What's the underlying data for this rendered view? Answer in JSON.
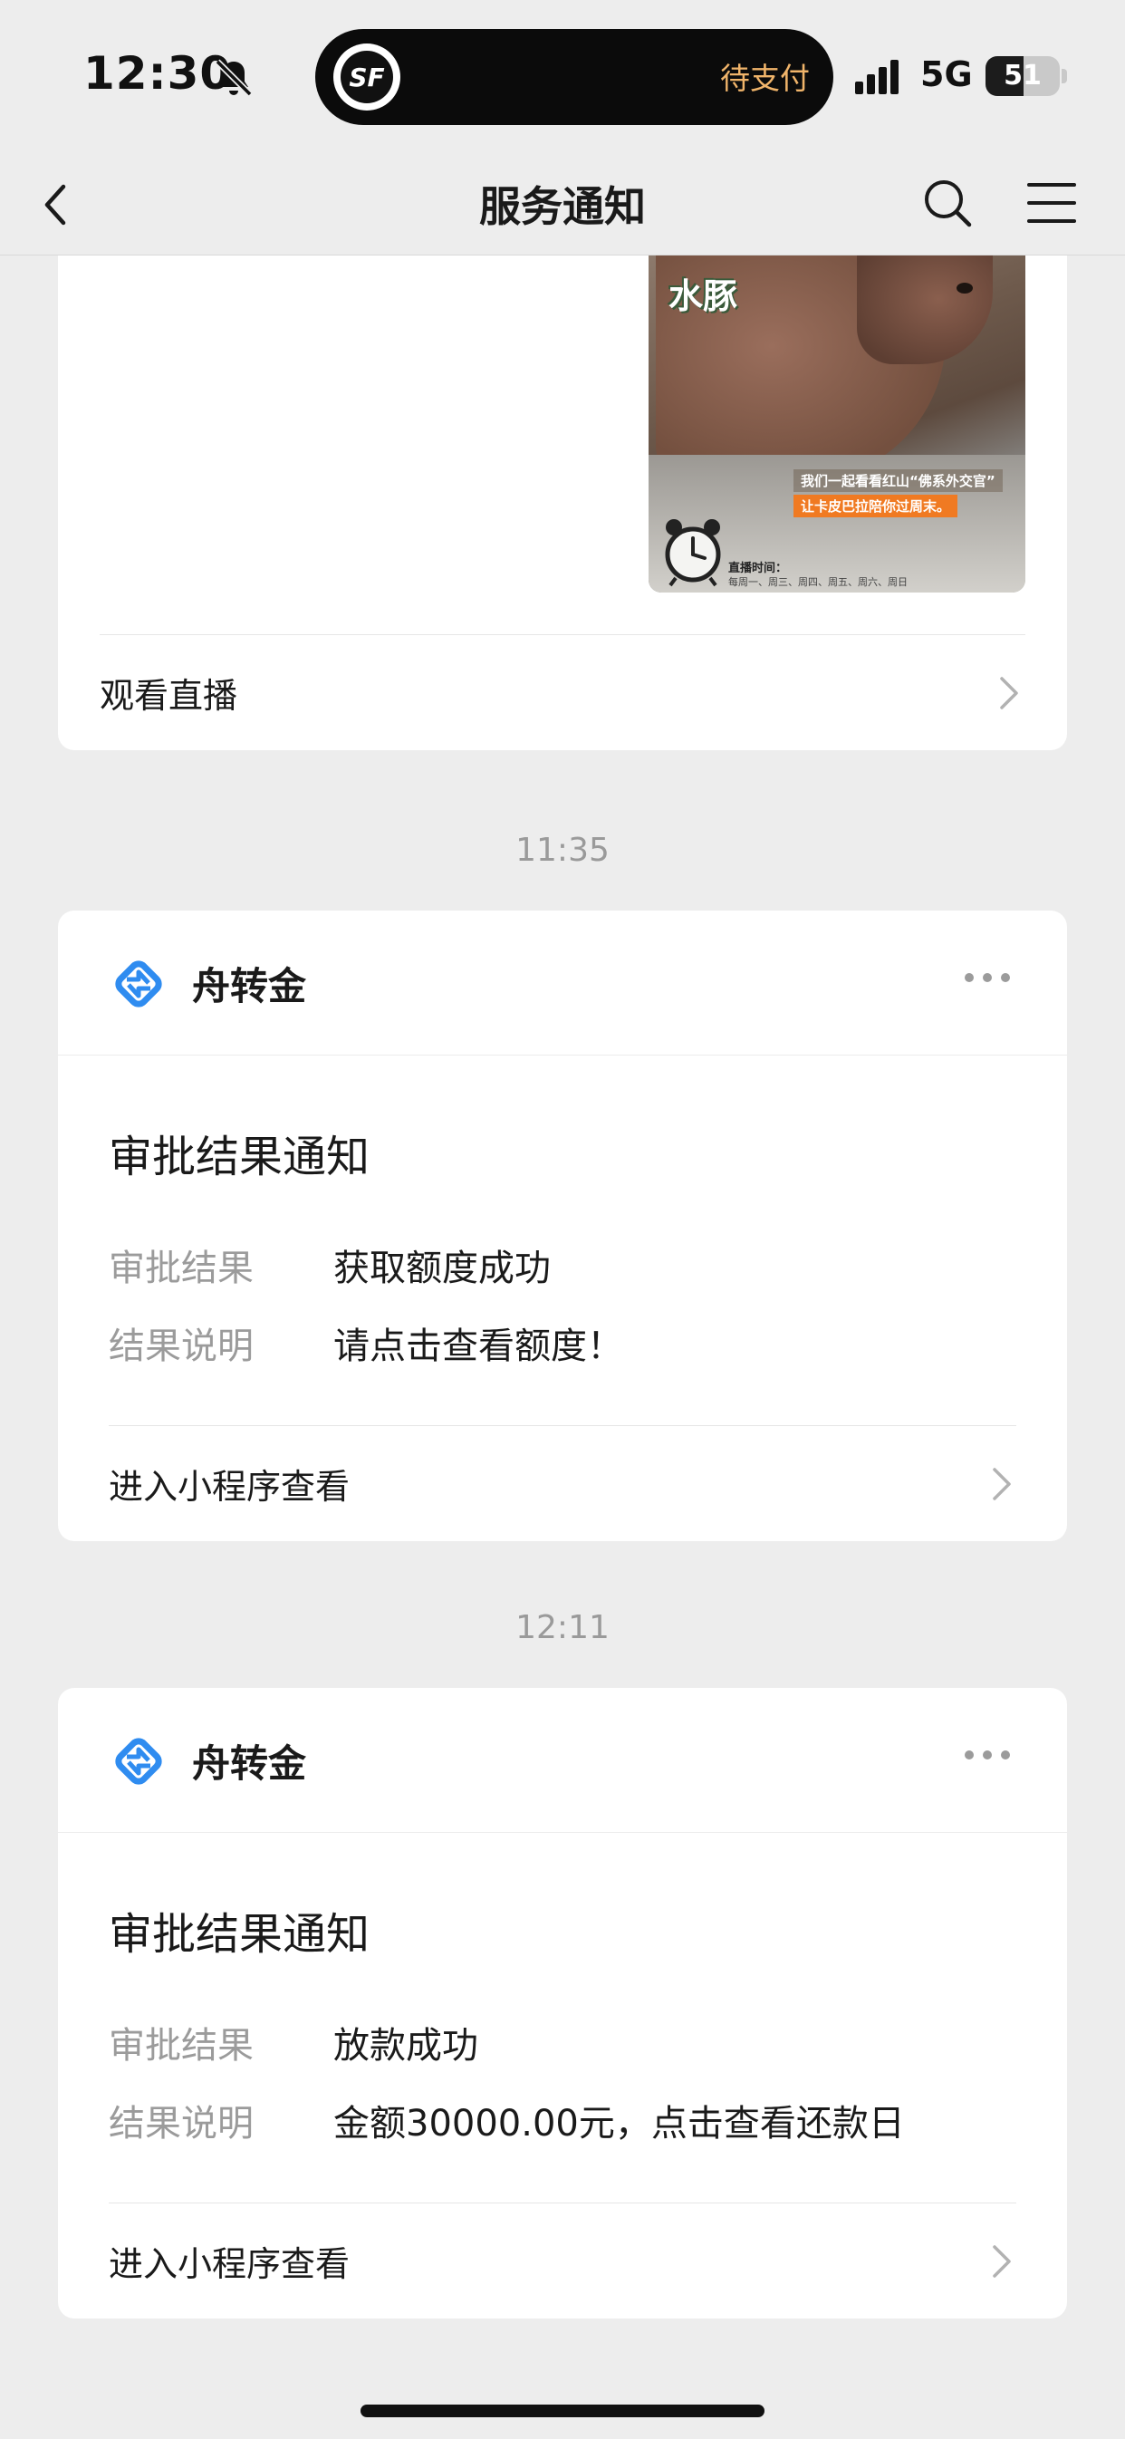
{
  "status_bar": {
    "time": "12:30",
    "island_logo": "SF",
    "island_text": "待支付",
    "network": "5G",
    "battery": "51",
    "battery_level": 0.51
  },
  "nav": {
    "title": "服务通知",
    "icons": [
      "back-icon",
      "search-icon",
      "menu-icon"
    ]
  },
  "live_card": {
    "image_title": "水豚",
    "image_caption_1": "我们一起看看红山“佛系外交官”",
    "image_caption_2": "让卡皮巴拉陪你过周末。",
    "image_schedule_label": "直播时间：",
    "image_schedule_days": "每周一、周三、周四、周五、周六、周日",
    "action_label": "观看直播"
  },
  "messages": [
    {
      "time": "11:35",
      "app_name": "舟转金",
      "title": "审批结果通知",
      "fields": [
        {
          "label": "审批结果",
          "value": "获取额度成功"
        },
        {
          "label": "结果说明",
          "value": "请点击查看额度！"
        }
      ],
      "action_label": "进入小程序查看"
    },
    {
      "time": "12:11",
      "app_name": "舟转金",
      "title": "审批结果通知",
      "fields": [
        {
          "label": "审批结果",
          "value": "放款成功"
        },
        {
          "label": "结果说明",
          "value": "金额30000.00元，点击查看还款日"
        }
      ],
      "action_label": "进入小程序查看"
    }
  ],
  "colors": {
    "background": "#ededed",
    "card": "#ffffff",
    "label_gray": "#9b9b9b",
    "brand_blue": "#2f8cf0",
    "island_accent": "#f0b46a"
  }
}
